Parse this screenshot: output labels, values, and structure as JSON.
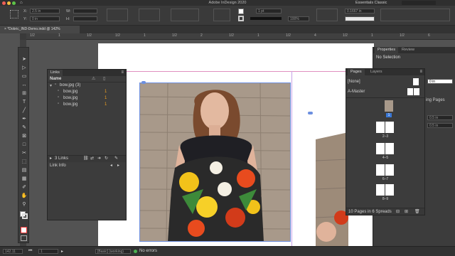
{
  "app": {
    "title": "Adobe InDesign 2020",
    "workspace": "Essentials Classic"
  },
  "control": {
    "x_value": "2.5 in",
    "y_value": "0 in",
    "w_value": "",
    "h_value": "",
    "stroke_weight": "1 pt",
    "zoom_pct": "100%",
    "gap_value": "0.1667 in",
    "x_label": "X:",
    "y_label": "Y:",
    "w_label": "W:",
    "h_label": "H:"
  },
  "document_tab": {
    "label": "*Dobric_IND-Demo.indd @ 142%",
    "close": "×"
  },
  "ruler": {
    "ticks": [
      "1/2",
      "1",
      "1/2",
      "1/2",
      "1",
      "1/2",
      "2",
      "1/2",
      "1",
      "1/2",
      "4",
      "1/2",
      "1",
      "1/2",
      "6"
    ]
  },
  "links_panel": {
    "title": "Links",
    "column_name": "Name",
    "group": {
      "name": "bow.jpg (3)",
      "count": ""
    },
    "items": [
      {
        "name": "bow.jpg",
        "page": "1"
      },
      {
        "name": "bow.jpg",
        "page": "1"
      },
      {
        "name": "bow.jpg",
        "page": "1"
      }
    ],
    "footer_count": "3 Links",
    "link_info_label": "Link Info"
  },
  "pages_panel": {
    "tabs": [
      "Pages",
      "Layers"
    ],
    "none_label": "[None]",
    "master_label": "A-Master",
    "spreads": [
      "1",
      "2–3",
      "4–5",
      "6–7",
      "8–9"
    ],
    "footer": "10 Pages in 6 Spreads"
  },
  "properties_panel": {
    "tabs": [
      "Properties",
      "Review"
    ],
    "selection": "No Selection",
    "values": [
      "0 in",
      "0.5 in",
      "0.5 in"
    ],
    "label_partial": "ing Pages"
  },
  "status": {
    "zoom": "142.11",
    "page": "1",
    "preflight_profile": "[Basic] (working)",
    "errors": "No errors"
  },
  "colors": {
    "accent": "#3a78d8",
    "ok": "#4caf50"
  }
}
